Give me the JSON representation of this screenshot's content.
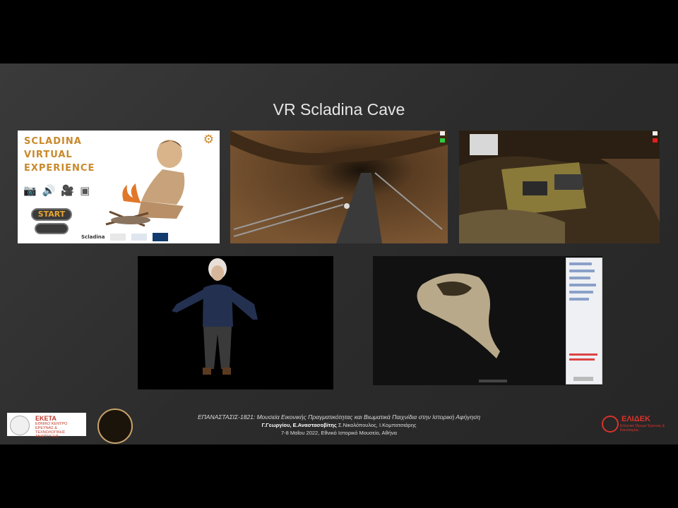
{
  "slide": {
    "title": "VR Scladina Cave"
  },
  "menu_panel": {
    "title_lines": [
      "Scladina",
      "virtual",
      "experience"
    ],
    "start_label": "START",
    "second_label": "",
    "logo_label": "Scladina",
    "icons": [
      "camera-icon",
      "speaker-icon",
      "video-camera-icon",
      "cube-3d-icon"
    ],
    "gear_icon": "gear-icon",
    "accent_color": "#c9892b"
  },
  "footer": {
    "line1": "ΕΠΑΝΑΣΤΑΣΙΣ-1821: Μουσεία Εικονικής Πραγματικότητας και Βιωματικά Παιχνίδια στην Ιστορική Αφήγηση",
    "line2_bold": "Γ.Γεωργίου, Ε.Αναστασοβίτης",
    "line2_rest": " Σ.Νικολόπουλος, Ι.Κομπατσιάρης",
    "line3": "7-8 Μαΐου 2022, Εθνικό Ιστορικό Μουσείο, Αθήνα"
  },
  "logos": {
    "eketa_name": "ΕΚΕΤΑ",
    "eketa_sub": "ΕΘΝΙΚΟ ΚΕΝΤΡΟ ΕΡΕΥΝΑΣ & ΤΕΧΝΟΛΟΓΙΚΗΣ ΑΝΑΠΤΥΞΗΣ",
    "elidek_name": "ΕΛΙΔΕΚ",
    "elidek_sub": "Ελληνικό Ίδρυμα Έρευνας & Καινοτομίας",
    "brand_red": "#d9322b"
  }
}
